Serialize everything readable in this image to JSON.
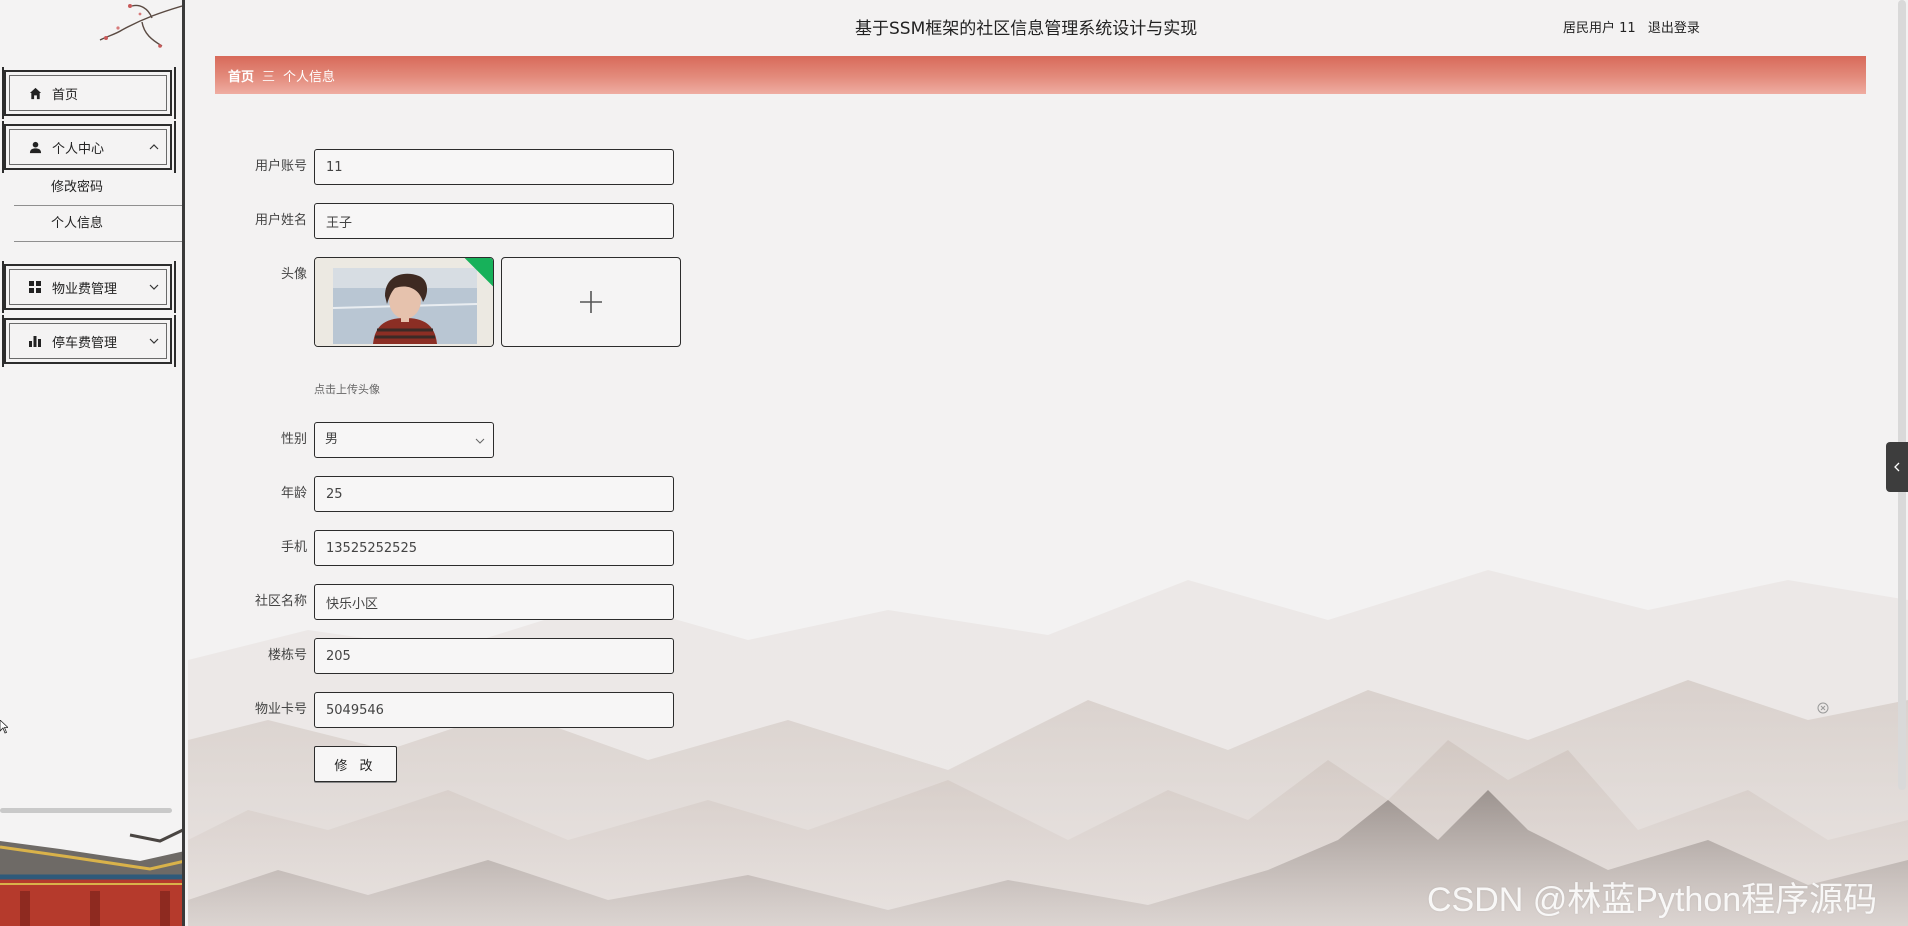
{
  "header": {
    "title": "基于SSM框架的社区信息管理系统设计与实现",
    "user_label": "居民用户 11",
    "logout_label": "退出登录"
  },
  "sidebar": {
    "items": [
      {
        "label": "首页",
        "icon": "home-icon"
      },
      {
        "label": "个人中心",
        "icon": "user-icon",
        "expanded": true,
        "children": [
          {
            "label": "修改密码"
          },
          {
            "label": "个人信息"
          }
        ]
      },
      {
        "label": "物业费管理",
        "icon": "grid-icon",
        "expanded": false
      },
      {
        "label": "停车费管理",
        "icon": "bar-chart-icon",
        "expanded": false
      }
    ]
  },
  "breadcrumb": {
    "home": "首页",
    "separator": "三",
    "current": "个人信息"
  },
  "form": {
    "account": {
      "label": "用户账号",
      "value": "11"
    },
    "name": {
      "label": "用户姓名",
      "value": "王子"
    },
    "avatar": {
      "label": "头像",
      "hint": "点击上传头像"
    },
    "gender": {
      "label": "性别",
      "value": "男"
    },
    "age": {
      "label": "年龄",
      "value": "25"
    },
    "phone": {
      "label": "手机",
      "value": "13525252525"
    },
    "community": {
      "label": "社区名称",
      "value": "快乐小区"
    },
    "building": {
      "label": "楼栋号",
      "value": "205"
    },
    "card": {
      "label": "物业卡号",
      "value": "5049546"
    },
    "submit_label": "修 改"
  },
  "watermark": "CSDN @林蓝Python程序源码",
  "colors": {
    "breadcrumb_bar": "#e07b6c",
    "sidebar_border": "#2c2c2c",
    "badge": "#17b15a"
  }
}
